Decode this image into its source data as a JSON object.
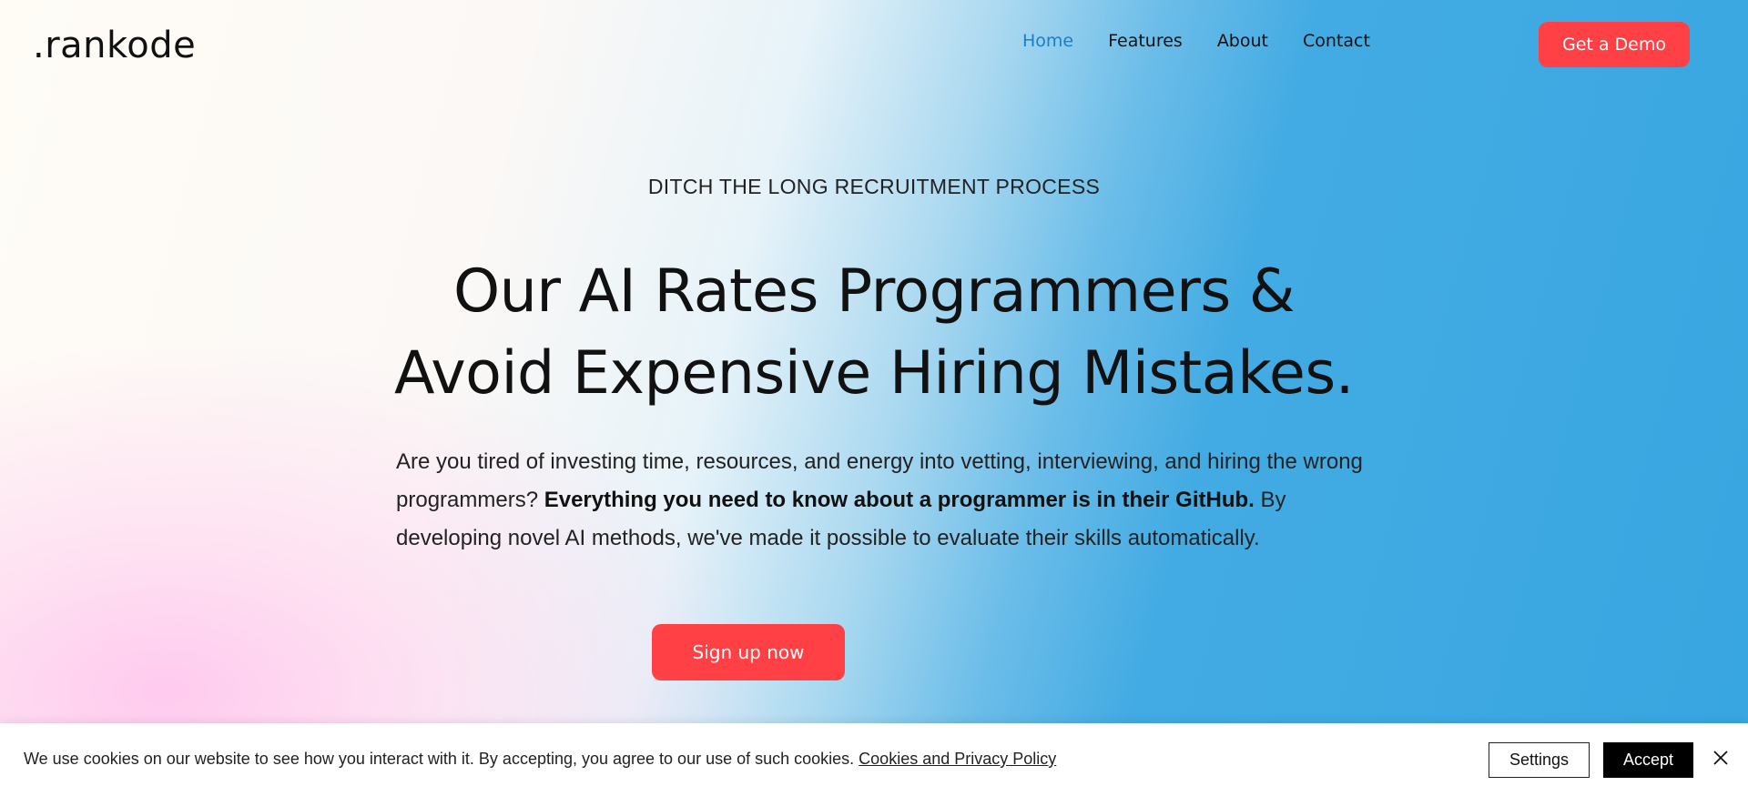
{
  "header": {
    "logo": ".rankode",
    "nav": [
      {
        "label": "Home",
        "active": true
      },
      {
        "label": "Features",
        "active": false
      },
      {
        "label": "About",
        "active": false
      },
      {
        "label": "Contact",
        "active": false
      }
    ],
    "demo_button": "Get a Demo"
  },
  "hero": {
    "eyebrow": "DITCH THE LONG RECRUITMENT PROCESS",
    "headline_line1": "Our AI Rates Programmers &",
    "headline_line2": "Avoid Expensive Hiring Mistakes.",
    "desc_part1": "Are you tired of investing time, resources, and energy into vetting, interviewing, and hiring the wrong programmers? ",
    "desc_bold": "Everything you need to know about a programmer is in their GitHub.",
    "desc_part2": " By developing novel AI methods, we've made it possible to evaluate their skills automatically.",
    "signup_button": "Sign up now"
  },
  "cookie": {
    "text": "We use cookies on our website to see how you interact with it. By accepting, you agree to our use of such cookies.",
    "link": "Cookies and Privacy Policy",
    "settings_button": "Settings",
    "accept_button": "Accept"
  },
  "colors": {
    "accent_red": "#ff4146",
    "nav_active": "#1a7fc4",
    "hero_blue": "#38a6e1",
    "hero_pink": "#ffc8ee"
  },
  "icons": {
    "close": "close-icon"
  }
}
